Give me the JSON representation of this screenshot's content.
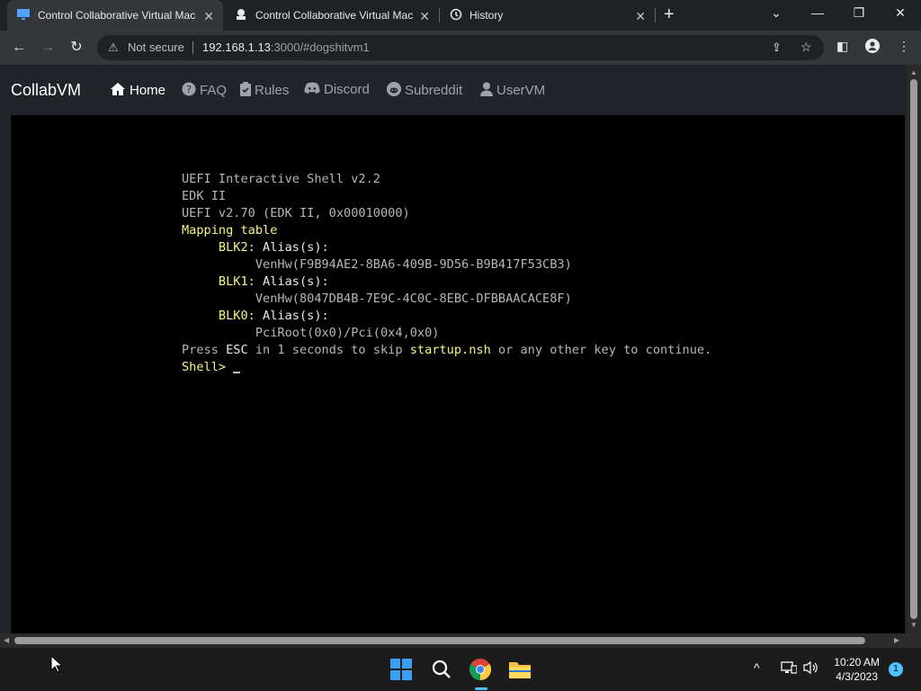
{
  "browser": {
    "tabs": [
      {
        "title": "Control Collaborative Virtual Mac",
        "icon": "monitor-icon",
        "active": true
      },
      {
        "title": "Control Collaborative Virtual Mac",
        "icon": "collabvm-icon",
        "active": false
      },
      {
        "title": "History",
        "icon": "history-icon",
        "active": false
      }
    ],
    "new_tab_label": "+",
    "omnibox": {
      "security_label": "Not secure",
      "url_host": "192.168.1.13",
      "url_rest": ":3000/#dogshitvm1"
    }
  },
  "site": {
    "brand": "CollabVM",
    "nav": [
      {
        "label": "Home",
        "icon": "home-icon",
        "active": true
      },
      {
        "label": "FAQ",
        "icon": "question-icon",
        "active": false
      },
      {
        "label": "Rules",
        "icon": "clipboard-check-icon",
        "active": false
      },
      {
        "label": "Discord",
        "icon": "discord-icon",
        "active": false
      },
      {
        "label": "Subreddit",
        "icon": "reddit-icon",
        "active": false
      },
      {
        "label": "UserVM",
        "icon": "user-icon",
        "active": false
      }
    ]
  },
  "terminal": {
    "line1": "UEFI Interactive Shell v2.2",
    "line2": "EDK II",
    "line3": "UEFI v2.70 (EDK II, 0x00010000)",
    "mapping_header": "Mapping table",
    "blk2_name": "BLK2:",
    "blk2_alias": "Alias(s):",
    "blk2_path": "VenHw(F9B94AE2-8BA6-409B-9D56-B9B417F53CB3)",
    "blk1_name": "BLK1:",
    "blk1_alias": "Alias(s):",
    "blk1_path": "VenHw(8047DB4B-7E9C-4C0C-8EBC-DFBBAACACE8F)",
    "blk0_name": "BLK0:",
    "blk0_alias": "Alias(s):",
    "blk0_path": "PciRoot(0x0)/Pci(0x4,0x0)",
    "press_a": "Press ",
    "press_esc": "ESC",
    "press_b": " in 1 seconds to skip ",
    "press_file": "startup.nsh",
    "press_c": " or any other key to continue.",
    "prompt": "Shell> "
  },
  "taskbar": {
    "apps": [
      "windows-start-icon",
      "search-icon",
      "chrome-icon",
      "file-explorer-icon"
    ],
    "time": "10:20 AM",
    "date": "4/3/2023",
    "notification_count": "1"
  },
  "colors": {
    "terminal_highlight": "#f4f486",
    "terminal_text": "#b6b6b6",
    "navbar_bg": "#212529"
  }
}
